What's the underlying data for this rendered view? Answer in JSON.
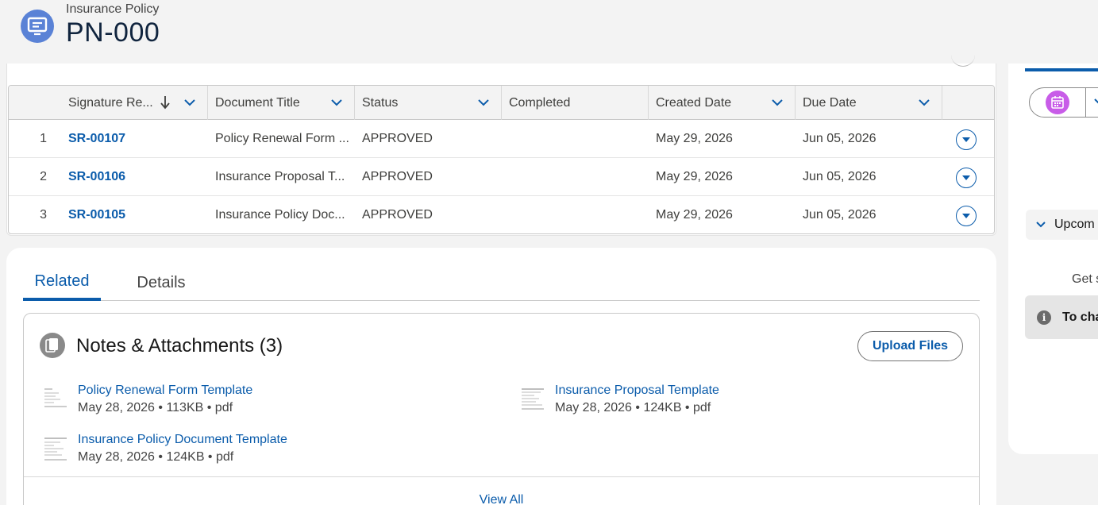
{
  "header": {
    "object_type": "Insurance Policy",
    "title": "PN-000",
    "icon": "record-icon"
  },
  "table": {
    "columns": [
      {
        "label": "Signature Re...",
        "sorted": "descending"
      },
      {
        "label": "Document Title"
      },
      {
        "label": "Status"
      },
      {
        "label": "Completed"
      },
      {
        "label": "Created Date"
      },
      {
        "label": "Due Date"
      }
    ],
    "rows": [
      {
        "num": "1",
        "signature": "SR-00107",
        "title": "Policy Renewal Form ...",
        "status": "APPROVED",
        "completed": "",
        "created": "May 29, 2026",
        "due": "Jun 05, 2026"
      },
      {
        "num": "2",
        "signature": "SR-00106",
        "title": "Insurance Proposal T...",
        "status": "APPROVED",
        "completed": "",
        "created": "May 29, 2026",
        "due": "Jun 05, 2026"
      },
      {
        "num": "3",
        "signature": "SR-00105",
        "title": "Insurance Policy Doc...",
        "status": "APPROVED",
        "completed": "",
        "created": "May 29, 2026",
        "due": "Jun 05, 2026"
      }
    ]
  },
  "tabs": [
    {
      "label": "Related",
      "active": true
    },
    {
      "label": "Details",
      "active": false
    }
  ],
  "notes": {
    "title": "Notes & Attachments (3)",
    "upload_label": "Upload Files",
    "files": [
      {
        "name": "Policy Renewal Form Template",
        "meta": "May 28, 2026 • 113KB • pdf"
      },
      {
        "name": "Insurance Proposal Template",
        "meta": "May 28, 2026 • 124KB • pdf"
      },
      {
        "name": "Insurance Policy Document Template",
        "meta": "May 28, 2026 • 124KB • pdf"
      }
    ],
    "view_all": "View All"
  },
  "right_panel": {
    "upcoming_label": "Upcom",
    "get_started": "Get s",
    "info_text": "To cha"
  },
  "colors": {
    "brand_blue": "#0b5cab",
    "header_icon": "#5a82d6",
    "calendar_icon": "#c85ce8"
  }
}
